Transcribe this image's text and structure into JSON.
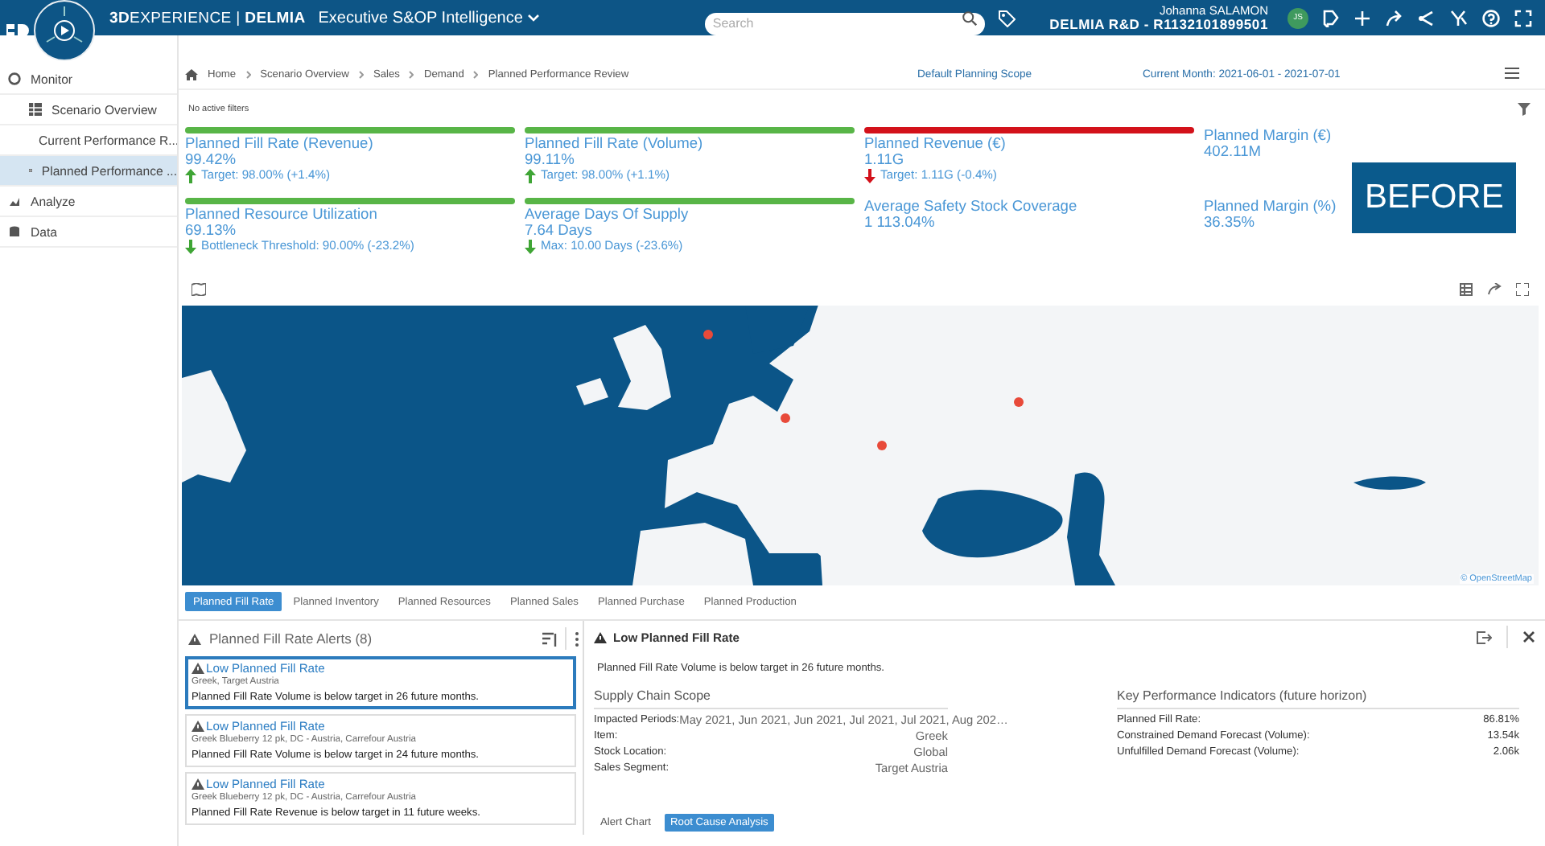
{
  "header": {
    "brand": "**3D**EXPERIENCE | **DELMIA**",
    "app_title": "Executive S&OP Intelligence",
    "search": {
      "placeholder": "Search"
    },
    "user_name": "Johanna SALAMON",
    "tenant": "DELMIA R&D - R1132101899501",
    "avatar": "JS"
  },
  "sidebar": {
    "items": [
      {
        "label": "Monitor",
        "selected": false,
        "children": [
          {
            "label": "Scenario Overview",
            "selected": false
          },
          {
            "label": "Current Performance R...",
            "selected": false
          },
          {
            "label": "Planned Performance ...",
            "selected": true
          }
        ]
      },
      {
        "label": "Analyze",
        "selected": false
      },
      {
        "label": "Data",
        "selected": false
      }
    ]
  },
  "breadcrumb": [
    "Home",
    "Scenario Overview",
    "Sales",
    "Demand",
    "Planned Performance Review"
  ],
  "scope": "Default Planning Scope",
  "current_month": "Current Month: 2021-06-01 - 2021-07-01",
  "filters": "No active filters",
  "kpis": [
    {
      "title": "Planned Fill Rate (Revenue)",
      "value": "99.42%",
      "color": "#58b547",
      "trend_up": true,
      "trend_good": true,
      "note": "Target: 98.00% (+1.4%)"
    },
    {
      "title": "Planned Fill Rate (Volume)",
      "value": "99.11%",
      "color": "#58b547",
      "trend_up": true,
      "trend_good": true,
      "note": "Target: 98.00% (+1.1%)"
    },
    {
      "title": "Planned Revenue (€)",
      "value": "1.11G",
      "color": "#d3111a",
      "trend_up": false,
      "trend_good": false,
      "note": "Target: 1.11G (-0.4%)"
    },
    {
      "title": "Planned Margin (€)",
      "value": "402.11M"
    },
    {
      "title": "Planned Resource Utilization",
      "value": "69.13%",
      "color": "#58b547",
      "trend_up": false,
      "trend_good": true,
      "note": "Bottleneck Threshold: 90.00% (-23.2%)"
    },
    {
      "title": "Average Days Of Supply",
      "value": "7.64 Days",
      "color": "#58b547",
      "trend_up": false,
      "trend_good": true,
      "note": "Max: 10.00 Days (-23.6%)"
    },
    {
      "title": "Average Safety Stock Coverage",
      "value": "1 113.04%"
    },
    {
      "title": "Planned Margin (%)",
      "value": "36.35%"
    }
  ],
  "stamp": "BEFORE",
  "map": {
    "attribution": "© OpenStreetMap"
  },
  "tabs": [
    {
      "label": "Planned Fill Rate",
      "selected": true
    },
    {
      "label": "Planned Inventory",
      "selected": false
    },
    {
      "label": "Planned Resources",
      "selected": false
    },
    {
      "label": "Planned Sales",
      "selected": false
    },
    {
      "label": "Planned Purchase",
      "selected": false
    },
    {
      "label": "Planned Production",
      "selected": false
    }
  ],
  "alerts": {
    "title": "Planned Fill Rate Alerts (8)",
    "items": [
      {
        "title": "Low Planned Fill Rate",
        "scope": "Greek, Target Austria",
        "message": "Planned Fill Rate Volume is below target in 26 future months.",
        "selected": true
      },
      {
        "title": "Low Planned Fill Rate",
        "scope": "Greek Blueberry 12 pk, DC - Austria, Carrefour Austria",
        "message": "Planned Fill Rate Volume is below target in 24 future months.",
        "selected": false
      },
      {
        "title": "Low Planned Fill Rate",
        "scope": "Greek Blueberry 12 pk, DC - Austria, Carrefour Austria",
        "message": "Planned Fill Rate Revenue is below target in 11 future weeks.",
        "selected": false
      }
    ]
  },
  "detail": {
    "title": "Low Planned Fill Rate",
    "message": "Planned Fill Rate Volume is below target in 26 future months.",
    "scope_title": "Supply Chain Scope",
    "scope_rows": [
      {
        "label": "Impacted Periods:",
        "value": "May 2021, Jun 2021, Jun 2021, Jul 2021, Jul 2021, Aug 202…"
      },
      {
        "label": "Item:",
        "value": "Greek"
      },
      {
        "label": "Stock Location:",
        "value": "Global"
      },
      {
        "label": "Sales Segment:",
        "value": "Target Austria"
      }
    ],
    "kpi_title": "Key Performance Indicators (future horizon)",
    "kpi_rows": [
      {
        "label": "Planned Fill Rate:",
        "value": "86.81%"
      },
      {
        "label": "Constrained Demand Forecast (Volume):",
        "value": "13.54k"
      },
      {
        "label": "Unfulfilled Demand Forecast (Volume):",
        "value": "2.06k"
      }
    ],
    "views": [
      {
        "label": "Alert Chart",
        "selected": false
      },
      {
        "label": "Root Cause Analysis",
        "selected": true
      }
    ]
  }
}
